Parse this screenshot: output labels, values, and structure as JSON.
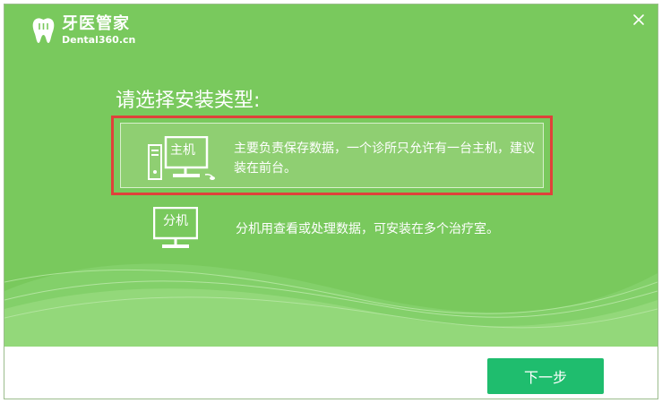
{
  "app": {
    "title": "牙医管家",
    "subtitle": "Dental360.cn"
  },
  "dialog": {
    "heading": "请选择安装类型:",
    "options": [
      {
        "label": "主机",
        "description": "主要负责保存数据，一个诊所只允许有一台主机，建议装在前台。",
        "selected": true
      },
      {
        "label": "分机",
        "description": "分机用查看或处理数据，可安装在多个治疗室。",
        "selected": false
      }
    ]
  },
  "footer": {
    "next_label": "下一步"
  },
  "colors": {
    "background_green": "#79c95d",
    "selected_border": "#e0413a",
    "button_green": "#1fbd6e"
  },
  "icons": {
    "logo": "tooth-icon",
    "close": "close-icon",
    "host": "desktop-computer-icon",
    "client": "monitor-icon"
  }
}
